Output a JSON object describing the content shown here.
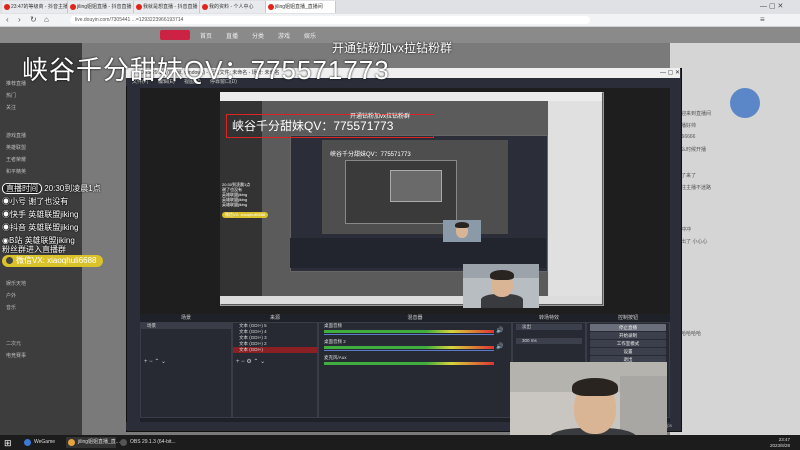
{
  "browser": {
    "tabs": [
      {
        "label": "23:47的等级商 - 抖音主播"
      },
      {
        "label": "jiling姐姐直播 - 抖音直播"
      },
      {
        "label": "我就是想直播 - 抖音直播"
      },
      {
        "label": "我的资料 - 个人中心"
      },
      {
        "label": "jiling姐姐直播_直播间"
      }
    ],
    "url": "live.douyin.com/7305441 ...=1293223966193714"
  },
  "site": {
    "nav": [
      "首页",
      "直播",
      "分类",
      "游戏",
      "娱乐",
      "更多"
    ],
    "sidebar": [
      "推荐直播",
      "热门",
      "关注",
      "游戏直播",
      "英雄联盟",
      "王者荣耀",
      "和平精英",
      "娱乐天地",
      "户外",
      "音乐",
      "二次元",
      "电竞赛事"
    ],
    "chat_lines": [
      "欢迎来到直播间",
      "主播好帅",
      "6666666",
      "什么时候开播",
      "来了来了",
      "关注主播不迷路",
      "冲冲冲",
      "送出了 小心心",
      "哈哈哈哈哈"
    ]
  },
  "overlays": {
    "watermark": "峡谷千分甜妹QV：775571773",
    "top_banner": "开通钻粉加vx拉钻粉群",
    "stream_info": [
      {
        "label": "直播时间",
        "value": "20:30到凌晨1点"
      },
      {
        "label": "小号",
        "value": "谢了也没有"
      },
      {
        "label": "快手",
        "value": "英雄联盟jiking"
      },
      {
        "label": "抖音",
        "value": "英雄联盟jiking"
      },
      {
        "label": "B站",
        "value": "英雄联盟jiking"
      }
    ],
    "merch": "粉丝群进入直播群",
    "vx": "微信VX: xiaoqhuli6688"
  },
  "obs": {
    "title": "OBS 29.1.3 (64-bit, windows) - 配置文件: 未命名 - 场景: 未命名",
    "menu": [
      "文件(F)",
      "编辑(E)",
      "视图(V)",
      "停靠窗口(D)",
      "配置文件(P)",
      "场景集合(S)",
      "工具(T)",
      "帮助(H)"
    ],
    "docks": {
      "scenes": "场景",
      "sources": "来源",
      "mixer": "混音器",
      "transitions": "转场特效",
      "controls": "控制按钮"
    },
    "scene_item": "场景",
    "source_items": [
      "文本 (GDI+) 5",
      "文本 (GDI+) 4",
      "文本 (GDI+) 3",
      "文本 (GDI+) 2",
      "文本 (GDI+)"
    ],
    "mixer_channels": [
      "桌面音频",
      "桌面音频 2",
      "麦克风/Aux"
    ],
    "transition": "淡出",
    "transition_duration": "300 ms",
    "controls": [
      "停止直播",
      "开始录制",
      "工作室模式",
      "设置",
      "退出"
    ],
    "status": "LIVE: 00:35:12  REC: 00:00:00  CPU: 4.1%  60.00 fps"
  },
  "taskbar": {
    "items": [
      "WeGame",
      "jiling姐姐直播_直...",
      "OBS 29.1.3 (64-bit..."
    ],
    "time": "23:47",
    "date": "2023/8/28"
  }
}
